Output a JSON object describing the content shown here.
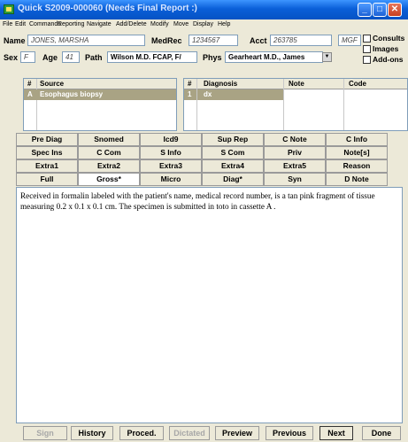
{
  "window": {
    "title": "Quick S2009-000060 (Needs Final Report :)"
  },
  "menu": [
    "File",
    "Edit",
    "Commands",
    "Reporting",
    "Navigate",
    "Add/Delete",
    "Modify",
    "Move",
    "Display",
    "Help"
  ],
  "patient": {
    "name_label": "Name",
    "name_value": "JONES, MARSHA",
    "medrec_label": "MedRec",
    "medrec_value": "1234567",
    "acct_label": "Acct",
    "acct_value": "263785",
    "mgf_value": "MGF",
    "sex_label": "Sex",
    "sex_value": "F",
    "age_label": "Age",
    "age_value": "41",
    "path_label": "Path",
    "path_value": "Wilson M.D. FCAP, F/",
    "phys_label": "Phys",
    "phys_value": "Gearheart M.D., James"
  },
  "checkboxes": {
    "consults": "Consults",
    "images": "Images",
    "addons": "Add-ons"
  },
  "source_grid": {
    "col_num": "#",
    "col_source": "Source",
    "rows": [
      {
        "num": "A",
        "source": "Esophagus biopsy"
      }
    ]
  },
  "diagnosis_grid": {
    "col_num": "#",
    "col_diagnosis": "Diagnosis",
    "col_note": "Note",
    "col_code": "Code",
    "rows": [
      {
        "num": "1",
        "diagnosis": "dx"
      }
    ]
  },
  "tabs": [
    [
      "Pre Diag",
      "Snomed",
      "Icd9",
      "Sup Rep",
      "C Note",
      "C Info"
    ],
    [
      "Spec Ins",
      "C Com",
      "S Info",
      "S Com",
      "Priv",
      "Note[s]"
    ],
    [
      "Extra1",
      "Extra2",
      "Extra3",
      "Extra4",
      "Extra5",
      "Reason"
    ],
    [
      "Full",
      "Gross*",
      "Micro",
      "Diag*",
      "Syn",
      "D Note"
    ]
  ],
  "gross_text": "Received in formalin labeled with the patient's name, medical record number, is a tan pink fragment of tissue measuring 0.2 x 0.1 x 0.1 cm. The specimen is submitted in toto in cassette A .",
  "bottom_buttons": {
    "sign": "Sign",
    "history": "History",
    "proced": "Proced.",
    "dictated": "Dictated",
    "preview": "Preview",
    "previous": "Previous",
    "next": "Next",
    "done": "Done"
  }
}
